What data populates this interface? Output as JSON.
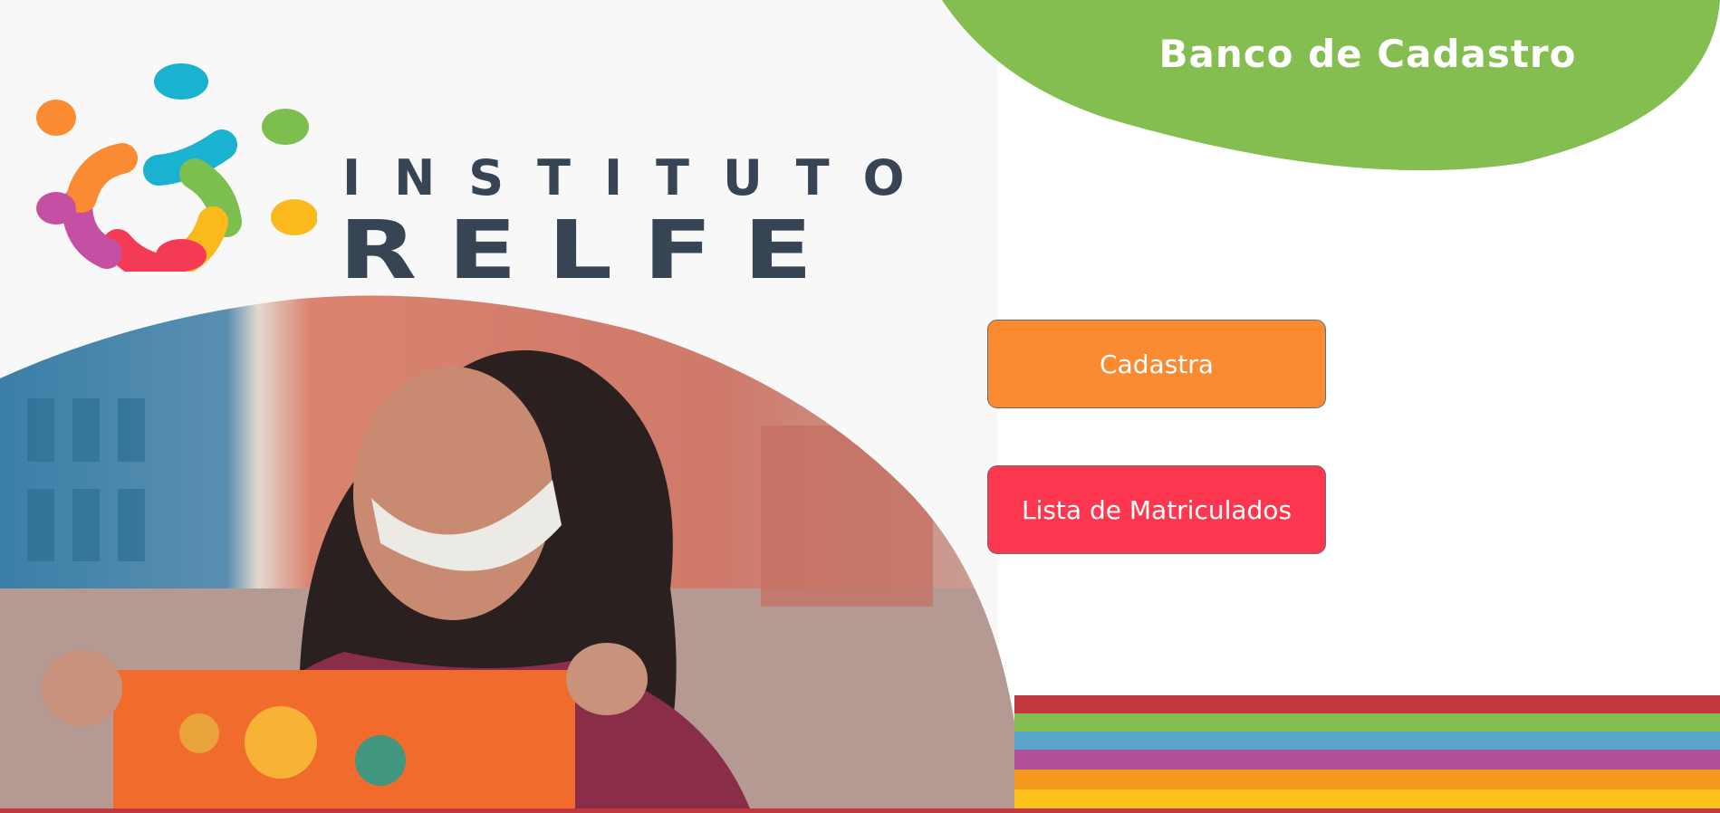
{
  "header": {
    "title": "Banco de Cadastro",
    "accent_color": "#84bd50"
  },
  "brand": {
    "logo_top_text": "INSTITUTO",
    "logo_bottom_text": "RELFE",
    "text_color": "#364454",
    "mark_colors": [
      "#1ab2d1",
      "#7dbf4f",
      "#fbb91d",
      "#f53a55",
      "#c44fa3",
      "#fb8b33"
    ]
  },
  "actions": {
    "register_label": "Cadastra",
    "register_color": "#fb8b33",
    "list_label": "Lista de Matriculados",
    "list_color": "#fd374f"
  },
  "stripe_colors": [
    "#c1383f",
    "#84bd50",
    "#58a6c9",
    "#b24f9a",
    "#f39a1f",
    "#fbc21e"
  ]
}
